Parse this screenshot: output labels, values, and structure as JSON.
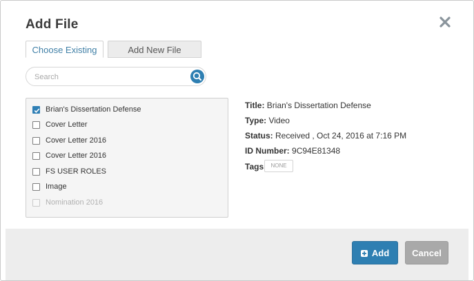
{
  "dialog": {
    "title": "Add File",
    "close_icon": "close-x-icon"
  },
  "tabs": [
    {
      "label": "Choose Existing",
      "active": true
    },
    {
      "label": "Add New File",
      "active": false
    }
  ],
  "search": {
    "placeholder": "Search",
    "value": "",
    "icon": "search-icon"
  },
  "files": [
    {
      "name": "Brian's Dissertation Defense",
      "checked": true
    },
    {
      "name": "Cover Letter",
      "checked": false
    },
    {
      "name": "Cover Letter 2016",
      "checked": false
    },
    {
      "name": "Cover Letter 2016",
      "checked": false
    },
    {
      "name": "FS USER ROLES",
      "checked": false
    },
    {
      "name": "Image",
      "checked": false
    },
    {
      "name": "Nomination 2016",
      "checked": false
    }
  ],
  "details": {
    "title_label": "Title:",
    "title_value": "Brian's Dissertation Defense",
    "type_label": "Type:",
    "type_value": "Video",
    "status_label": "Status:",
    "status_value": "Received , Oct 24, 2016 at 7:16 PM",
    "id_label": "ID Number:",
    "id_value": "9C94E81348",
    "tags_label": "Tags:",
    "tags_value": "NONE"
  },
  "footer": {
    "add_label": "Add",
    "add_icon": "plus-square-icon",
    "cancel_label": "Cancel"
  },
  "colors": {
    "accent": "#2e7fb2",
    "cancel": "#a9a9a9",
    "footer_bg": "#ededed"
  }
}
